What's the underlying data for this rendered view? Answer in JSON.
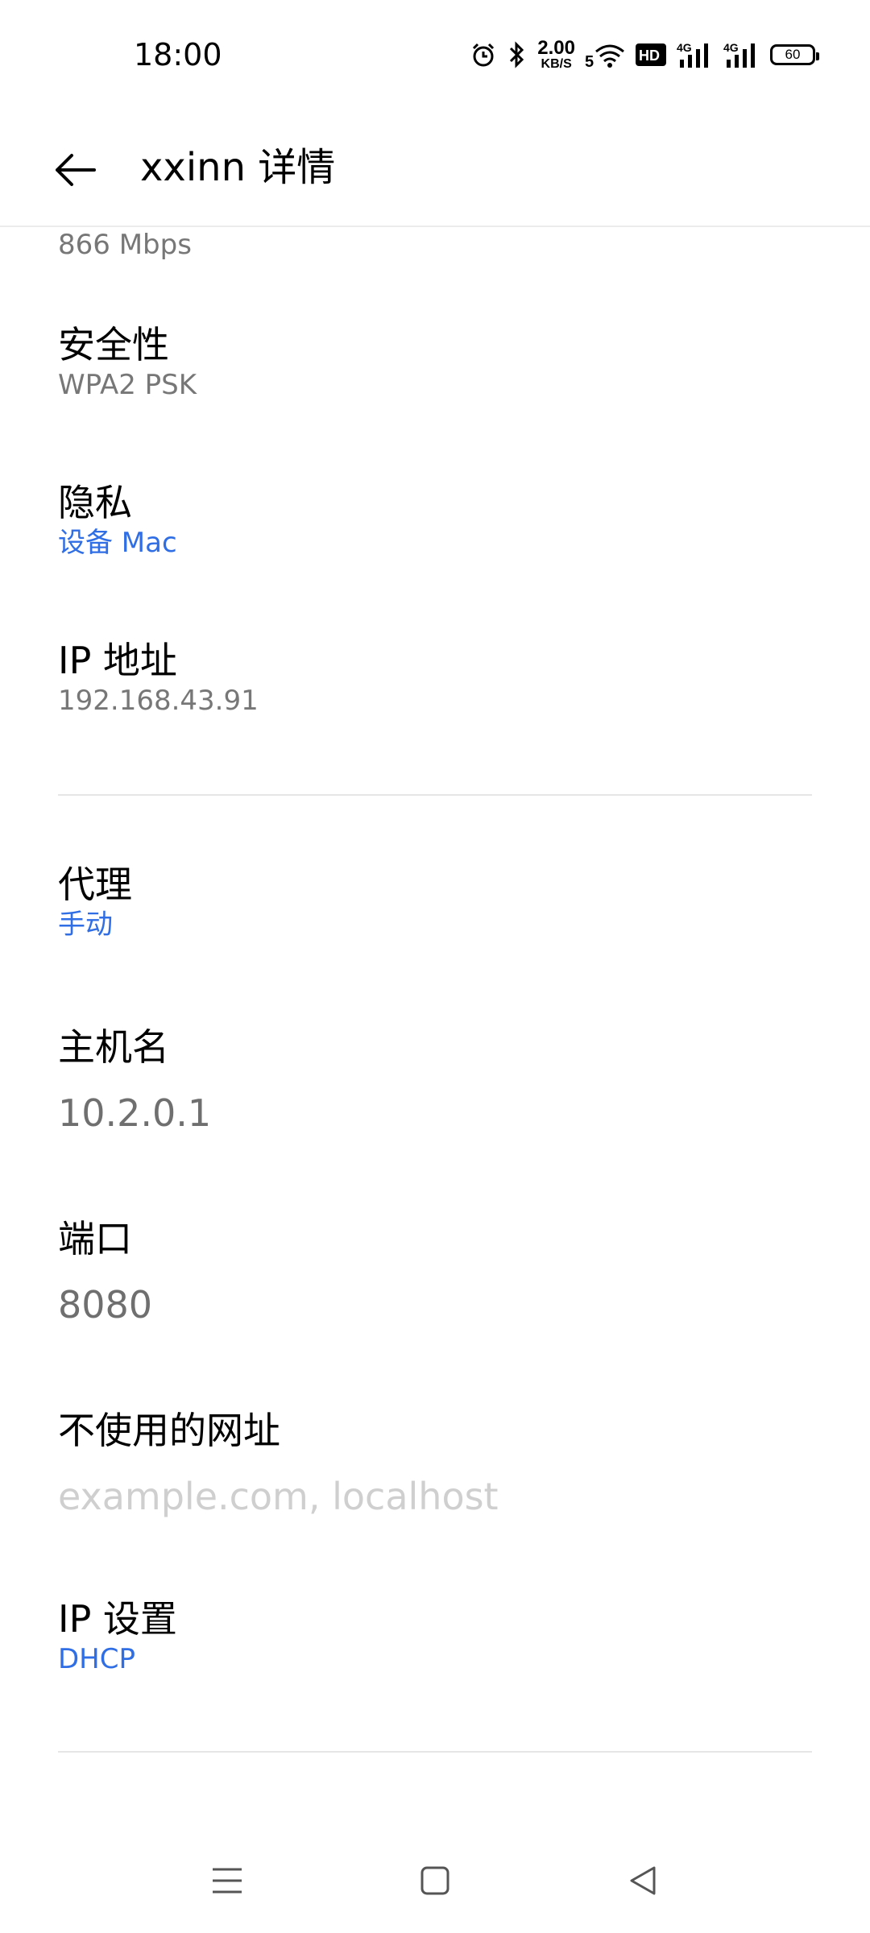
{
  "status_bar": {
    "time": "18:00",
    "net_speed_value": "2.00",
    "net_speed_unit": "KB/S",
    "wifi_band": "5",
    "hd_badge": "HD",
    "signal_1_label": "4G",
    "signal_2_label": "4G",
    "battery_level": "60",
    "icons": [
      "alarm-icon",
      "bluetooth-icon",
      "wifi-icon",
      "hd-voice-icon",
      "signal-icon",
      "signal-icon",
      "battery-icon"
    ]
  },
  "app_bar": {
    "title": "xxinn 详情",
    "back_icon": "arrow-left-icon"
  },
  "details": {
    "link_speed": "866 Mbps",
    "security": {
      "title": "安全性",
      "value": "WPA2 PSK"
    },
    "privacy": {
      "title": "隐私",
      "value": "设备 Mac"
    },
    "ip_address": {
      "title": "IP 地址",
      "value": "192.168.43.91"
    }
  },
  "proxy": {
    "title": "代理",
    "value": "手动",
    "hostname": {
      "label": "主机名",
      "value": "10.2.0.1"
    },
    "port": {
      "label": "端口",
      "value": "8080"
    },
    "bypass": {
      "label": "不使用的网址",
      "placeholder": "example.com, localhost"
    }
  },
  "ip_settings": {
    "title": "IP 设置",
    "value": "DHCP"
  },
  "nav_bar": {
    "icons": [
      "menu-icon",
      "home-icon",
      "back-triangle-icon"
    ]
  },
  "colors": {
    "link": "#2f6ee4",
    "secondary_text": "#777777",
    "placeholder": "#cfcfcf",
    "divider": "#e6e6e6"
  }
}
